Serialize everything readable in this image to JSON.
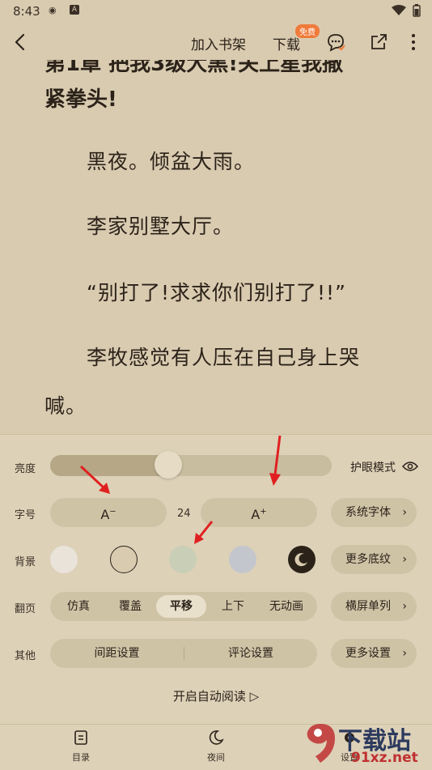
{
  "status": {
    "time": "8:43",
    "icon_a": "weibo-icon",
    "icon_b": "A"
  },
  "header": {
    "add_shelf": "加入书架",
    "download": "下载",
    "free_badge": "免费"
  },
  "reader": {
    "chapter_line2": "紧拳头!",
    "paragraphs": [
      "黑夜。倾盆大雨。",
      "李家别墅大厅。",
      "“别打了!求求你们别打了!!”",
      "李牧感觉有人压在自己身上哭",
      "喊。"
    ]
  },
  "panel": {
    "brightness_label": "亮度",
    "brightness_level": 0.42,
    "eye_mode": "护眼模式",
    "font_size_label": "字号",
    "font_size_value": "24",
    "system_font": "系统字体",
    "background_label": "背景",
    "more_backgrounds": "更多底纹",
    "backgrounds": [
      "#e9e3da",
      "#d9cbb0",
      "#c9cfb6",
      "#c3c6cd",
      "#2b2219"
    ],
    "page_turn_label": "翻页",
    "page_turn_options": [
      "仿真",
      "覆盖",
      "平移",
      "上下",
      "无动画"
    ],
    "page_turn_selected": "平移",
    "landscape": "横屏单列",
    "other_label": "其他",
    "spacing": "间距设置",
    "comments": "评论设置",
    "more_settings": "更多设置",
    "auto_read": "开启自动阅读 ▷"
  },
  "nav": {
    "toc": "目录",
    "night": "夜间",
    "settings": "设置"
  },
  "watermark": {
    "main": "下载站",
    "sub": "91xz.net"
  }
}
